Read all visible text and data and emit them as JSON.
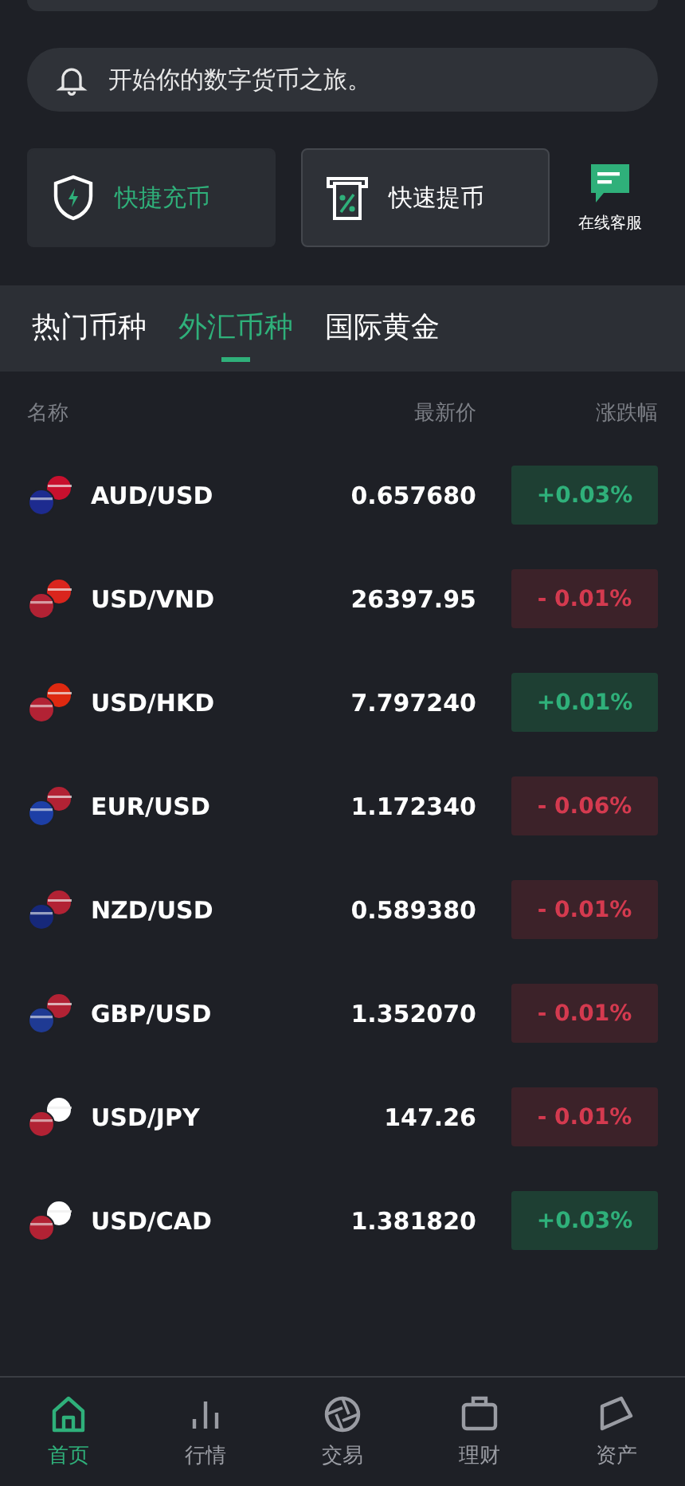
{
  "notice": {
    "text": "开始你的数字货币之旅。"
  },
  "quick_actions": [
    {
      "label": "快捷充币",
      "kind": "deposit",
      "selected": true
    },
    {
      "label": "快速提币",
      "kind": "withdraw",
      "selected": false
    }
  ],
  "support": {
    "label": "在线客服"
  },
  "tabs": [
    {
      "label": "热门币种",
      "selected": false
    },
    {
      "label": "外汇币种",
      "selected": true
    },
    {
      "label": "国际黄金",
      "selected": false
    }
  ],
  "table": {
    "columns": [
      "名称",
      "最新价",
      "涨跌幅"
    ],
    "rows": [
      {
        "pair": "AUD/USD",
        "price": "0.657680",
        "change": "+0.03%",
        "kind": "up"
      },
      {
        "pair": "USD/VND",
        "price": "26397.95",
        "change": "- 0.01%",
        "kind": "down"
      },
      {
        "pair": "USD/HKD",
        "price": "7.797240",
        "change": "+0.01%",
        "kind": "up"
      },
      {
        "pair": "EUR/USD",
        "price": "1.172340",
        "change": "- 0.06%",
        "kind": "down"
      },
      {
        "pair": "NZD/USD",
        "price": "0.589380",
        "change": "- 0.01%",
        "kind": "down"
      },
      {
        "pair": "GBP/USD",
        "price": "1.352070",
        "change": "- 0.01%",
        "kind": "down"
      },
      {
        "pair": "USD/JPY",
        "price": "147.26",
        "change": "- 0.01%",
        "kind": "down"
      },
      {
        "pair": "USD/CAD",
        "price": "1.381820",
        "change": "+0.03%",
        "kind": "up"
      }
    ]
  },
  "bottom_nav": [
    {
      "label": "首页",
      "kind": "home",
      "selected": true
    },
    {
      "label": "行情",
      "kind": "market",
      "selected": false
    },
    {
      "label": "交易",
      "kind": "trade",
      "selected": false
    },
    {
      "label": "理财",
      "kind": "finance",
      "selected": false
    },
    {
      "label": "资产",
      "kind": "assets",
      "selected": false
    }
  ]
}
